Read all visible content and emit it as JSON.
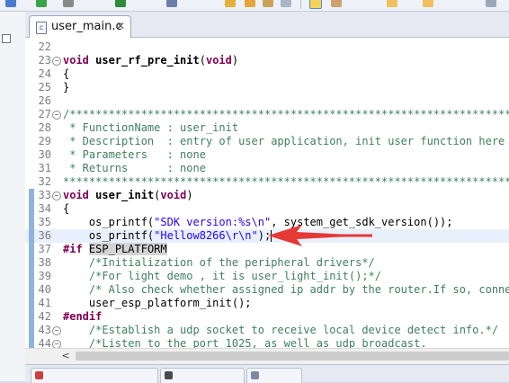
{
  "colors": {
    "accent": "#e53935",
    "keyword": "#7f0055",
    "comment": "#3f7f5f",
    "string": "#2a00ff"
  },
  "editor_tab": {
    "icon": "c-source-file-icon",
    "icon_glyph": "c",
    "label": "user_main.c",
    "close_glyph": "✕"
  },
  "code_lines": [
    {
      "n": "22",
      "segs": []
    },
    {
      "n": "23",
      "fold": true,
      "segs": [
        {
          "t": "void",
          "c": "kw"
        },
        {
          "t": " "
        },
        {
          "t": "user_rf_pre_init",
          "c": "fn"
        },
        {
          "t": "("
        },
        {
          "t": "void",
          "c": "kw"
        },
        {
          "t": ")"
        }
      ]
    },
    {
      "n": "24",
      "segs": [
        {
          "t": "{"
        }
      ]
    },
    {
      "n": "25",
      "segs": [
        {
          "t": "}"
        }
      ]
    },
    {
      "n": "26",
      "segs": []
    },
    {
      "n": "27",
      "fold": true,
      "segs": [
        {
          "t": "/**************************************************************************",
          "c": "cm"
        }
      ]
    },
    {
      "n": "28",
      "segs": [
        {
          "t": " * FunctionName : user_init",
          "c": "cm"
        }
      ]
    },
    {
      "n": "29",
      "segs": [
        {
          "t": " * Description  : entry of user application, init user function here",
          "c": "cm"
        }
      ]
    },
    {
      "n": "30",
      "segs": [
        {
          "t": " * Parameters   : none",
          "c": "cm"
        }
      ]
    },
    {
      "n": "31",
      "segs": [
        {
          "t": " * Returns      : none",
          "c": "cm"
        }
      ]
    },
    {
      "n": "32",
      "segs": [
        {
          "t": "***************************************************************************",
          "c": "cm"
        }
      ]
    },
    {
      "n": "33",
      "fold": true,
      "mark": true,
      "segs": [
        {
          "t": "void",
          "c": "kw"
        },
        {
          "t": " "
        },
        {
          "t": "user_init",
          "c": "fn"
        },
        {
          "t": "("
        },
        {
          "t": "void",
          "c": "kw"
        },
        {
          "t": ")"
        }
      ]
    },
    {
      "n": "34",
      "mark": true,
      "segs": [
        {
          "t": "{"
        }
      ]
    },
    {
      "n": "35",
      "mark": true,
      "segs": [
        {
          "t": "    os_printf("
        },
        {
          "t": "\"SDK version:%s\\n\"",
          "c": "str"
        },
        {
          "t": ", system_get_sdk_version());"
        }
      ]
    },
    {
      "n": "36",
      "mark": true,
      "current": true,
      "caret": true,
      "segs": [
        {
          "t": "    os_printf("
        },
        {
          "t": "\"Hellow8266\\r\\n\"",
          "c": "str"
        },
        {
          "t": ");"
        }
      ]
    },
    {
      "n": "37",
      "mark": true,
      "segs": [
        {
          "t": "#if",
          "c": "pp"
        },
        {
          "t": " "
        },
        {
          "t": "ESP_PLATFORM",
          "c": "macro"
        }
      ]
    },
    {
      "n": "38",
      "mark": true,
      "segs": [
        {
          "t": "    /*Initialization of the peripheral drivers*/",
          "c": "cm"
        }
      ]
    },
    {
      "n": "39",
      "mark": true,
      "segs": [
        {
          "t": "    /*For light demo , it is user_light_init();*/",
          "c": "cm"
        }
      ]
    },
    {
      "n": "40",
      "mark": true,
      "segs": [
        {
          "t": "    /* Also check whether assigned ip addr by the router.If so, connect",
          "c": "cm"
        }
      ]
    },
    {
      "n": "41",
      "mark": true,
      "segs": [
        {
          "t": "    user_esp_platform_init();"
        }
      ]
    },
    {
      "n": "42",
      "mark": true,
      "segs": [
        {
          "t": "#endif",
          "c": "pp"
        }
      ]
    },
    {
      "n": "43",
      "fold": true,
      "mark": true,
      "segs": [
        {
          "t": "    /*Establish a udp socket to receive local device detect info.*/",
          "c": "cm"
        }
      ]
    },
    {
      "n": "44",
      "fold": true,
      "mark": true,
      "segs": [
        {
          "t": "    /*Listen to the port 1025, as well as udp broadcast.",
          "c": "cm"
        }
      ]
    }
  ],
  "scrollbar": {
    "left_arrow": "<"
  },
  "annotation": {
    "type": "red-arrow-pointer",
    "points_to_line": "36"
  }
}
